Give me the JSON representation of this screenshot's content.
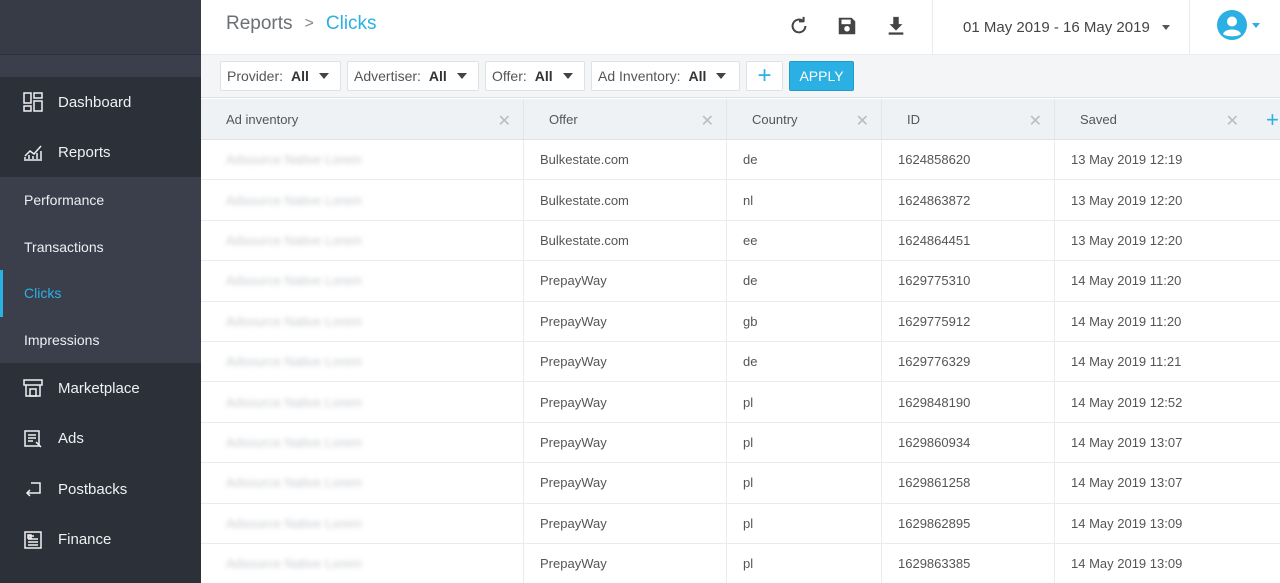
{
  "sidebar": {
    "items_top": [
      {
        "label": "Dashboard",
        "icon": "dashboard-icon"
      },
      {
        "label": "Reports",
        "icon": "reports-icon"
      }
    ],
    "sub_items": [
      {
        "label": "Performance"
      },
      {
        "label": "Transactions"
      },
      {
        "label": "Clicks"
      },
      {
        "label": "Impressions"
      }
    ],
    "items_bottom": [
      {
        "label": "Marketplace",
        "icon": "marketplace-icon"
      },
      {
        "label": "Ads",
        "icon": "ads-icon"
      },
      {
        "label": "Postbacks",
        "icon": "postbacks-icon"
      },
      {
        "label": "Finance",
        "icon": "finance-icon"
      }
    ]
  },
  "header": {
    "breadcrumb_parent": "Reports",
    "breadcrumb_separator": ">",
    "breadcrumb_current": "Clicks",
    "date_range": "01 May 2019 - 16 May 2019"
  },
  "filters": [
    {
      "label": "Provider:",
      "value": "All"
    },
    {
      "label": "Advertiser:",
      "value": "All"
    },
    {
      "label": "Offer:",
      "value": "All"
    },
    {
      "label": "Ad Inventory:",
      "value": "All"
    }
  ],
  "filter_add": "+",
  "apply_label": "APPLY",
  "table": {
    "columns": [
      "Ad inventory",
      "Offer",
      "Country",
      "ID",
      "Saved"
    ],
    "rows": [
      {
        "ad": "Adsource Native Lorem",
        "offer": "Bulkestate.com",
        "country": "de",
        "id": "1624858620",
        "saved": "13 May 2019 12:19"
      },
      {
        "ad": "Adsource Native Lorem",
        "offer": "Bulkestate.com",
        "country": "nl",
        "id": "1624863872",
        "saved": "13 May 2019 12:20"
      },
      {
        "ad": "Adsource Native Lorem",
        "offer": "Bulkestate.com",
        "country": "ee",
        "id": "1624864451",
        "saved": "13 May 2019 12:20"
      },
      {
        "ad": "Adsource Native Lorem",
        "offer": "PrepayWay",
        "country": "de",
        "id": "1629775310",
        "saved": "14 May 2019 11:20"
      },
      {
        "ad": "Adsource Native Lorem",
        "offer": "PrepayWay",
        "country": "gb",
        "id": "1629775912",
        "saved": "14 May 2019 11:20"
      },
      {
        "ad": "Adsource Native Lorem",
        "offer": "PrepayWay",
        "country": "de",
        "id": "1629776329",
        "saved": "14 May 2019 11:21"
      },
      {
        "ad": "Adsource Native Lorem",
        "offer": "PrepayWay",
        "country": "pl",
        "id": "1629848190",
        "saved": "14 May 2019 12:52"
      },
      {
        "ad": "Adsource Native Lorem",
        "offer": "PrepayWay",
        "country": "pl",
        "id": "1629860934",
        "saved": "14 May 2019 13:07"
      },
      {
        "ad": "Adsource Native Lorem",
        "offer": "PrepayWay",
        "country": "pl",
        "id": "1629861258",
        "saved": "14 May 2019 13:07"
      },
      {
        "ad": "Adsource Native Lorem",
        "offer": "PrepayWay",
        "country": "pl",
        "id": "1629862895",
        "saved": "14 May 2019 13:09"
      },
      {
        "ad": "Adsource Native Lorem",
        "offer": "PrepayWay",
        "country": "pl",
        "id": "1629863385",
        "saved": "14 May 2019 13:09"
      }
    ]
  },
  "colors": {
    "accent": "#2bb0e4",
    "sidebar_bg": "#3a3f4b",
    "sidebar_dark": "#2c3039"
  }
}
